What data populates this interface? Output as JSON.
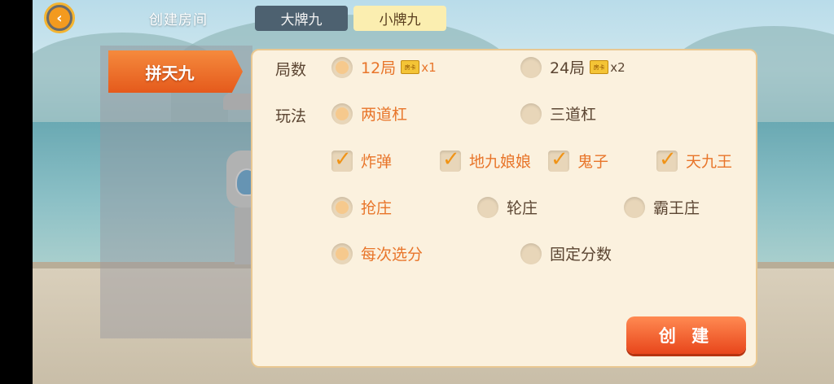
{
  "header": {
    "title": "创建房间",
    "tabs": [
      {
        "label": "大牌九",
        "active": false
      },
      {
        "label": "小牌九",
        "active": true
      }
    ]
  },
  "sidebar": {
    "items": [
      {
        "label": "拼天九",
        "active": true
      }
    ]
  },
  "form": {
    "rounds": {
      "label": "局数",
      "options": [
        {
          "label": "12局",
          "badge": "房卡",
          "cost": "x1",
          "selected": true
        },
        {
          "label": "24局",
          "badge": "房卡",
          "cost": "x2",
          "selected": false
        }
      ]
    },
    "play": {
      "label": "玩法",
      "modes": [
        {
          "label": "两道杠",
          "selected": true
        },
        {
          "label": "三道杠",
          "selected": false
        }
      ],
      "extras": [
        {
          "label": "炸弹",
          "checked": true
        },
        {
          "label": "地九娘娘",
          "checked": true
        },
        {
          "label": "鬼子",
          "checked": true
        },
        {
          "label": "天九王",
          "checked": true
        }
      ],
      "banker": [
        {
          "label": "抢庄",
          "selected": true
        },
        {
          "label": "轮庄",
          "selected": false
        },
        {
          "label": "霸王庄",
          "selected": false
        }
      ],
      "scoring": [
        {
          "label": "每次选分",
          "selected": true
        },
        {
          "label": "固定分数",
          "selected": false
        }
      ]
    }
  },
  "actions": {
    "create_label": "创 建"
  },
  "colors": {
    "accent": "#e8752a",
    "button": "#e8461b",
    "panel": "#fbf1de"
  },
  "icons": {
    "back": "back-arrow-icon",
    "card": "room-card-icon"
  }
}
